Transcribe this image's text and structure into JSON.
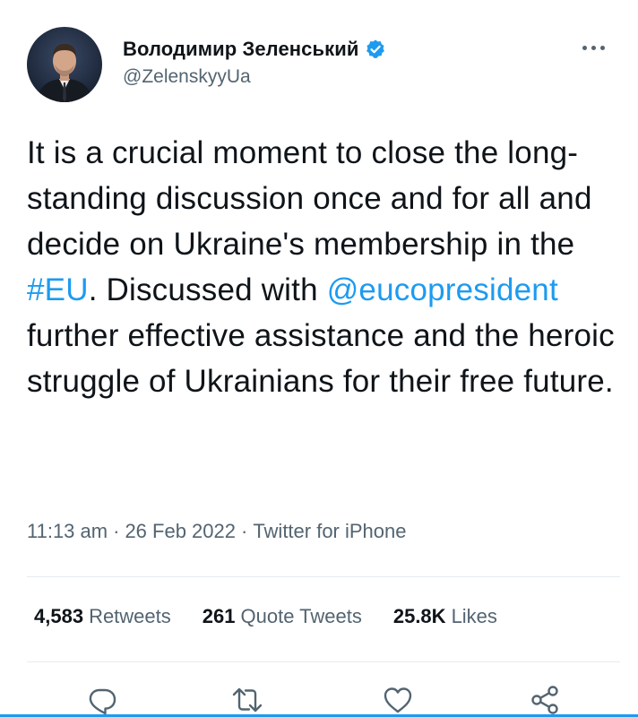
{
  "author": {
    "display_name": "Володимир Зеленський",
    "handle": "@ZelenskyyUa",
    "verified": true,
    "avatar_icon": "profile-photo"
  },
  "tweet": {
    "segments": [
      {
        "text": "It is a crucial moment to close the long-standing discussion once and for all and decide on Ukraine's membership in the ",
        "link": false
      },
      {
        "text": "#EU",
        "link": true
      },
      {
        "text": ". Discussed with ",
        "link": false
      },
      {
        "text": "@eucopresident",
        "link": true
      },
      {
        "text": " further effective assistance and the heroic struggle of Ukrainians for their free future.",
        "link": false
      }
    ]
  },
  "meta": {
    "time": "11:13 am",
    "separator": "·",
    "date": "26 Feb 2022",
    "source": "Twitter for iPhone"
  },
  "stats": {
    "retweets_count": "4,583",
    "retweets_label": "Retweets",
    "quotes_count": "261",
    "quotes_label": "Quote Tweets",
    "likes_count": "25.8K",
    "likes_label": "Likes"
  },
  "actions": {
    "icons": [
      "reply-icon",
      "retweet-icon",
      "like-icon",
      "share-icon"
    ]
  },
  "colors": {
    "accent": "#1d9bf0",
    "text": "#0f1419",
    "muted": "#536471",
    "divider": "#e6ecf0"
  }
}
